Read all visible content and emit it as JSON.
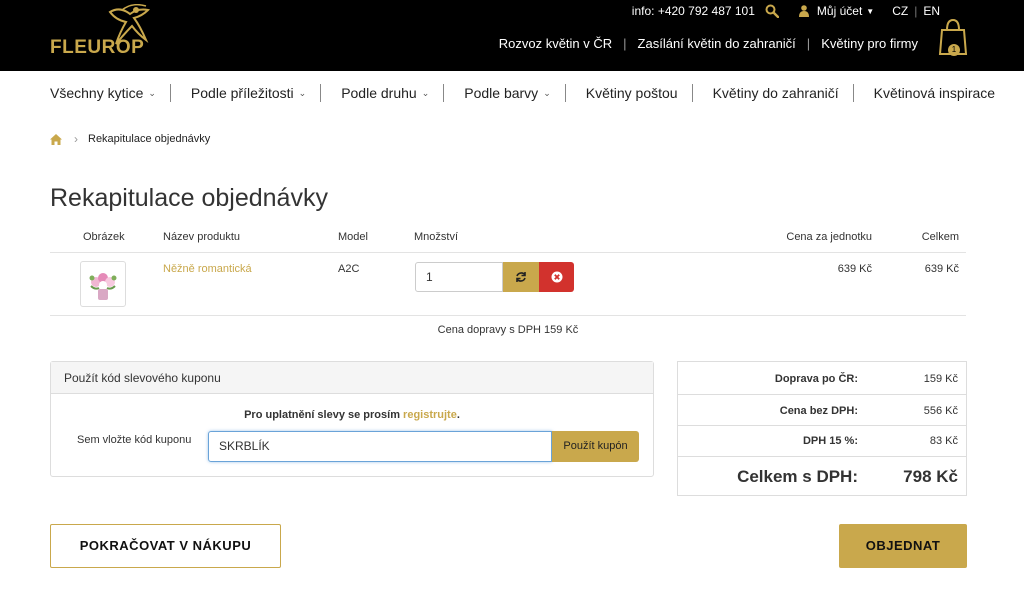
{
  "brand": {
    "logo_text": "FLEUROP",
    "accent": "#c9a84c"
  },
  "top_utils": {
    "info_label": "info:",
    "phone": "+420 792 487 101",
    "account_label": "Můj účet",
    "lang_cz": "CZ",
    "lang_en": "EN"
  },
  "top_links": [
    "Rozvoz květin v ČR",
    "Zasílání květin do zahraničí",
    "Květiny pro firmy"
  ],
  "cart": {
    "count": "1"
  },
  "main_nav": [
    {
      "label": "Všechny kytice",
      "dropdown": true
    },
    {
      "label": "Podle příležitosti",
      "dropdown": true
    },
    {
      "label": "Podle druhu",
      "dropdown": true
    },
    {
      "label": "Podle barvy",
      "dropdown": true
    },
    {
      "label": "Květiny poštou",
      "dropdown": false
    },
    {
      "label": "Květiny do zahraničí",
      "dropdown": false
    },
    {
      "label": "Květinová inspirace",
      "dropdown": false
    }
  ],
  "breadcrumb": {
    "current": "Rekapitulace objednávky"
  },
  "page_title": "Rekapitulace objednávky",
  "table": {
    "headers": {
      "image": "Obrázek",
      "name": "Název produktu",
      "model": "Model",
      "qty": "Množství",
      "unit_price": "Cena za jednotku",
      "total": "Celkem"
    },
    "rows": [
      {
        "name": "Něžně romantická",
        "model": "A2C",
        "qty": "1",
        "unit_price": "639 Kč",
        "total": "639 Kč"
      }
    ],
    "shipping_note": "Cena dopravy s DPH 159 Kč"
  },
  "coupon": {
    "title": "Použít kód slevového kuponu",
    "message_prefix": "Pro uplatnění slevy se prosím ",
    "message_link": "registrujte",
    "message_suffix": ".",
    "label": "Sem vložte kód kuponu",
    "value": "SKRBLÍK",
    "button": "Použít kupón"
  },
  "totals": {
    "shipping_label": "Doprava po ČR:",
    "shipping_value": "159 Kč",
    "net_label": "Cena bez DPH:",
    "net_value": "556 Kč",
    "vat_label": "DPH 15 %:",
    "vat_value": "83 Kč",
    "grand_label": "Celkem s DPH:",
    "grand_value": "798 Kč"
  },
  "buttons": {
    "continue": "POKRAČOVAT V NÁKUPU",
    "order": "OBJEDNAT"
  }
}
